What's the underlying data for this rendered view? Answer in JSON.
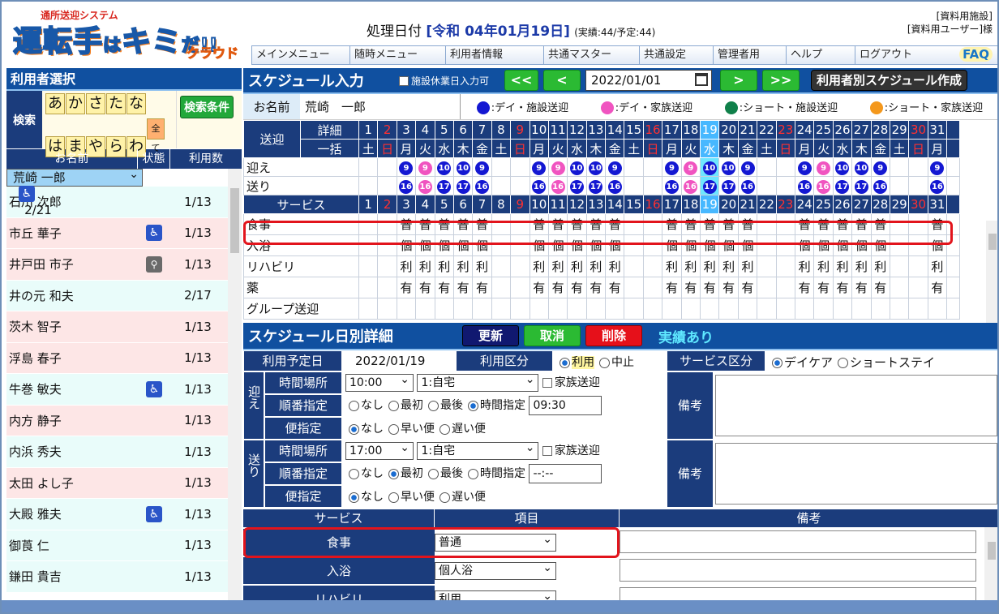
{
  "app": {
    "logo_sub": "通所送迎システム",
    "logo_main_a": "運転手",
    "logo_main_b": "は",
    "logo_main_c": "キミ",
    "logo_main_d": "だ!!",
    "logo_cloud": "クラウド"
  },
  "header": {
    "proc_label": "処理日付",
    "proc_date": "[令和 04年01月19日]",
    "proc_stat": "(実績:44/予定:44)",
    "facility": "[資料用施設]",
    "user": "[資料用ユーザー]様"
  },
  "menu": [
    "メインメニュー",
    "随時メニュー",
    "利用者情報",
    "共通マスター",
    "共通設定",
    "管理者用",
    "ヘルプ",
    "ログアウト"
  ],
  "faq": "FAQ",
  "left": {
    "title": "利用者選択",
    "search_label": "検索",
    "kana_row1": [
      "あ",
      "か",
      "さ",
      "た",
      "な"
    ],
    "kana_row2": [
      "は",
      "ま",
      "や",
      "ら",
      "わ",
      "全て"
    ],
    "cond_btn": "検索条件",
    "cols": [
      "お名前",
      "状態",
      "利用数"
    ],
    "users": [
      {
        "name": "荒崎 一郎",
        "st": "wc",
        "count": "2/21",
        "cls": "sel"
      },
      {
        "name": "石川 次郎",
        "st": "",
        "count": "1/13",
        "cls": "even"
      },
      {
        "name": "市丘 華子",
        "st": "wc",
        "count": "1/13",
        "cls": "odd"
      },
      {
        "name": "井戸田 市子",
        "st": "wk",
        "count": "1/13",
        "cls": "odd"
      },
      {
        "name": "井の元 和夫",
        "st": "",
        "count": "2/17",
        "cls": "even"
      },
      {
        "name": "茨木 智子",
        "st": "",
        "count": "1/13",
        "cls": "odd"
      },
      {
        "name": "浮島 春子",
        "st": "",
        "count": "1/13",
        "cls": "odd"
      },
      {
        "name": "牛巻 敏夫",
        "st": "wc",
        "count": "1/13",
        "cls": "even"
      },
      {
        "name": "内方 静子",
        "st": "",
        "count": "1/13",
        "cls": "odd"
      },
      {
        "name": "内浜 秀夫",
        "st": "",
        "count": "1/13",
        "cls": "even"
      },
      {
        "name": "太田 よし子",
        "st": "",
        "count": "1/13",
        "cls": "odd"
      },
      {
        "name": "大殿 雅夫",
        "st": "wc",
        "count": "1/13",
        "cls": "even"
      },
      {
        "name": "御莨 仁",
        "st": "",
        "count": "1/13",
        "cls": "even"
      },
      {
        "name": "鎌田 貴吉",
        "st": "",
        "count": "1/13",
        "cls": "even"
      }
    ]
  },
  "schedule": {
    "title": "スケジュール入力",
    "holiday_chk": "施設休業日入力可",
    "prev2": "<<",
    "prev": "<",
    "date": "2022/01/01",
    "next": ">",
    "next2": ">>",
    "per_user_btn": "利用者別スケジュール作成",
    "name_label": "お名前",
    "name": "荒崎　一郎",
    "legend": [
      {
        "c": "#1418d2",
        "t": ":デイ・施設送迎"
      },
      {
        "c": "#f054c0",
        "t": ":デイ・家族送迎"
      },
      {
        "c": "#10804a",
        "t": ":ショート・施設送迎"
      },
      {
        "c": "#f4981c",
        "t": ":ショート・家族送迎"
      }
    ],
    "sougei_label": "送迎",
    "detail_label": "詳細",
    "ikkatsu_label": "一括",
    "service_label": "サービス",
    "days": [
      "1",
      "2",
      "3",
      "4",
      "5",
      "6",
      "7",
      "8",
      "9",
      "10",
      "11",
      "12",
      "13",
      "14",
      "15",
      "16",
      "17",
      "18",
      "19",
      "20",
      "21",
      "22",
      "23",
      "24",
      "25",
      "26",
      "27",
      "28",
      "29",
      "30",
      "31"
    ],
    "weekdays": [
      "土",
      "日",
      "月",
      "火",
      "水",
      "木",
      "金",
      "土",
      "日",
      "月",
      "火",
      "水",
      "木",
      "金",
      "土",
      "日",
      "月",
      "火",
      "水",
      "木",
      "金",
      "土",
      "日",
      "月",
      "火",
      "水",
      "木",
      "金",
      "土",
      "日",
      "月"
    ],
    "red_days": [
      2,
      9,
      16,
      23,
      30
    ],
    "today_index": 19,
    "pickup_label": "迎え",
    "drop_label": "送り",
    "pickup": [
      "",
      "",
      "9",
      "9",
      "10",
      "10",
      "9",
      "",
      "",
      "9",
      "9",
      "10",
      "10",
      "9",
      "",
      "",
      "9",
      "9",
      "10",
      "10",
      "9",
      "",
      "",
      "9",
      "9",
      "10",
      "10",
      "9",
      "",
      "",
      "9"
    ],
    "pickup_pink": [
      4,
      11,
      18,
      25
    ],
    "drop": [
      "",
      "",
      "16",
      "16",
      "17",
      "17",
      "16",
      "",
      "",
      "16",
      "16",
      "17",
      "17",
      "16",
      "",
      "",
      "16",
      "16",
      "17",
      "17",
      "16",
      "",
      "",
      "16",
      "16",
      "17",
      "17",
      "16",
      "",
      "",
      "16"
    ],
    "services": [
      {
        "label": "食事",
        "mark": "普"
      },
      {
        "label": "入浴",
        "mark": "個"
      },
      {
        "label": "リハビリ",
        "mark": "利"
      },
      {
        "label": "薬",
        "mark": "有"
      },
      {
        "label": "グループ送迎",
        "mark": ""
      }
    ],
    "service_days": [
      3,
      4,
      5,
      6,
      7,
      10,
      11,
      12,
      13,
      14,
      17,
      18,
      19,
      20,
      21,
      24,
      25,
      26,
      27,
      28,
      31
    ]
  },
  "detail": {
    "title": "スケジュール日別詳細",
    "update": "更新",
    "cancel": "取消",
    "delete": "削除",
    "record": "実績あり",
    "plan_date_label": "利用予定日",
    "plan_date": "2022/01/19",
    "use_kubun_label": "利用区分",
    "use": "利用",
    "stop": "中止",
    "svc_kubun_label": "サービス区分",
    "daycare": "デイケア",
    "shortstay": "ショートステイ",
    "pickup_group": "迎え",
    "drop_group": "送り",
    "time_place": "時間場所",
    "order": "順番指定",
    "bin": "便指定",
    "pickup_time": "10:00",
    "pickup_place": "1:自宅",
    "family": "家族送迎",
    "none": "なし",
    "first": "最初",
    "last": "最後",
    "timed": "時間指定",
    "pickup_spec_time": "09:30",
    "early": "早い便",
    "late": "遅い便",
    "drop_time": "17:00",
    "drop_place": "1:自宅",
    "drop_spec_time": "--:--",
    "remarks": "備考"
  },
  "svc_table": {
    "col_service": "サービス",
    "col_item": "項目",
    "col_remarks": "備考",
    "rows": [
      {
        "name": "食事",
        "item": "普通"
      },
      {
        "name": "入浴",
        "item": "個人浴"
      },
      {
        "name": "リハビリ",
        "item": "利用"
      }
    ]
  }
}
